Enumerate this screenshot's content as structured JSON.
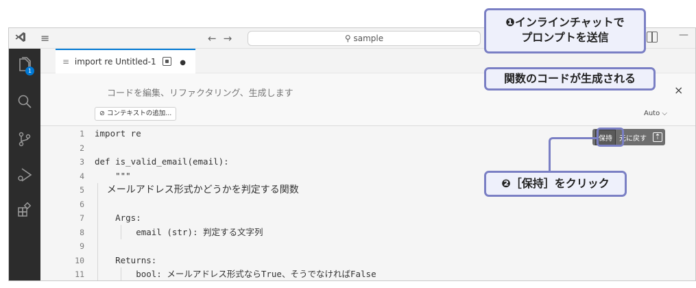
{
  "titlebar": {
    "search_text": "sample",
    "nav_back": "←",
    "nav_forward": "→",
    "menu_glyph": "≡",
    "minimize_glyph": "—"
  },
  "activity_bar": {
    "explorer_badge": "1",
    "icons": [
      "files-icon",
      "search-icon",
      "source-control-icon",
      "run-debug-icon",
      "extensions-icon"
    ]
  },
  "tab": {
    "title": "import re Untitled-1",
    "modified_dot": "●"
  },
  "inline_chat": {
    "placeholder": "コードを編集、リファクタリング、生成します",
    "add_context": "コンテキストの追加...",
    "model": "Auto",
    "close": "×"
  },
  "keep_toolbar": {
    "keep_label": "保持",
    "revert_label": "元に戻す"
  },
  "code_lines": [
    {
      "n": "1",
      "text": "import re",
      "jp": false,
      "indent": 0
    },
    {
      "n": "2",
      "text": "",
      "jp": false,
      "indent": 0
    },
    {
      "n": "3",
      "text": "def is_valid_email(email):",
      "jp": false,
      "indent": 0
    },
    {
      "n": "4",
      "text": "    \"\"\"",
      "jp": false,
      "indent": 0
    },
    {
      "n": "5",
      "text": "    メールアドレス形式かどうかを判定する関数",
      "jp": true,
      "indent": 0
    },
    {
      "n": "6",
      "text": "",
      "jp": false,
      "indent": 0
    },
    {
      "n": "7",
      "text": "    Args:",
      "jp": false,
      "indent": 0
    },
    {
      "n": "8",
      "text": "        email (str): 判定する文字列",
      "jp": false,
      "indent": 0
    },
    {
      "n": "9",
      "text": "",
      "jp": false,
      "indent": 0
    },
    {
      "n": "10",
      "text": "    Returns:",
      "jp": false,
      "indent": 0
    },
    {
      "n": "11",
      "text": "        bool: メールアドレス形式ならTrue、そうでなければFalse",
      "jp": false,
      "indent": 0
    }
  ],
  "callouts": {
    "step1_num": "❶",
    "step1_line1": "インラインチャットで",
    "step1_line2": "プロンプトを送信",
    "step2_text": "関数のコードが生成される",
    "step3_num": "❷",
    "step3_text": "［保持］をクリック"
  },
  "colors": {
    "accent": "#0078d4",
    "callout_border": "#7a7fc4",
    "activity_bg": "#2c2c2c"
  }
}
